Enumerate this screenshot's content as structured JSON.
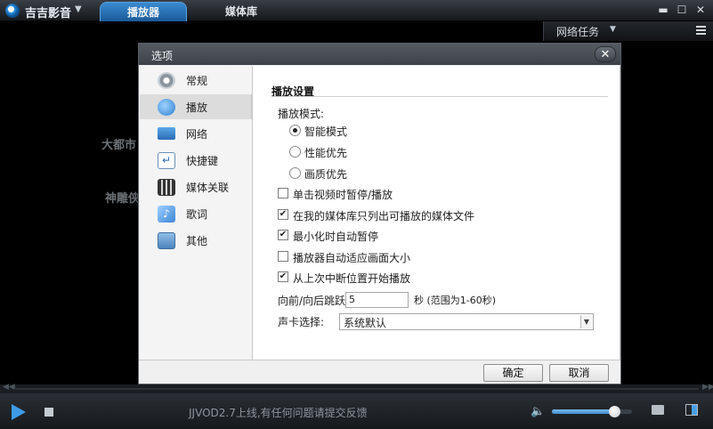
{
  "app": {
    "title": "吉吉影音",
    "tabs": [
      "播放器",
      "媒体库"
    ],
    "window_buttons": [
      "minimize-icon",
      "maximize-icon",
      "close-icon"
    ]
  },
  "topbar": {
    "net_tasks": "网络任务"
  },
  "background_text": [
    "大都市",
    "神雕侠"
  ],
  "dialog": {
    "title": "选项",
    "nav": [
      {
        "label": "常规",
        "icon": "gear-icon"
      },
      {
        "label": "播放",
        "icon": "play-icon"
      },
      {
        "label": "网络",
        "icon": "network-icon"
      },
      {
        "label": "快捷键",
        "icon": "shortcut-icon"
      },
      {
        "label": "媒体关联",
        "icon": "media-assoc-icon"
      },
      {
        "label": "歌词",
        "icon": "lyrics-icon"
      },
      {
        "label": "其他",
        "icon": "other-icon"
      }
    ],
    "active_nav": "播放",
    "section_title": "播放设置",
    "mode_label": "播放模式:",
    "modes": [
      {
        "label": "智能模式",
        "selected": true
      },
      {
        "label": "性能优先",
        "selected": false
      },
      {
        "label": "画质优先",
        "selected": false
      }
    ],
    "options": [
      {
        "label": "单击视频时暂停/播放",
        "checked": false
      },
      {
        "label": "在我的媒体库只列出可播放的媒体文件",
        "checked": true
      },
      {
        "label": "最小化时自动暂停",
        "checked": true
      },
      {
        "label": "播放器自动适应画面大小",
        "checked": false
      },
      {
        "label": "从上次中断位置开始播放",
        "checked": true
      }
    ],
    "skip_label": "向前/向后跳跃时长:",
    "skip_value": "5",
    "skip_unit": "秒 (范围为1-60秒)",
    "sound_label": "声卡选择:",
    "sound_value": "系统默认",
    "ok": "确定",
    "cancel": "取消"
  },
  "player": {
    "status": "JJVOD2.7上线,有任何问题请提交反馈",
    "volume": 0.78
  }
}
